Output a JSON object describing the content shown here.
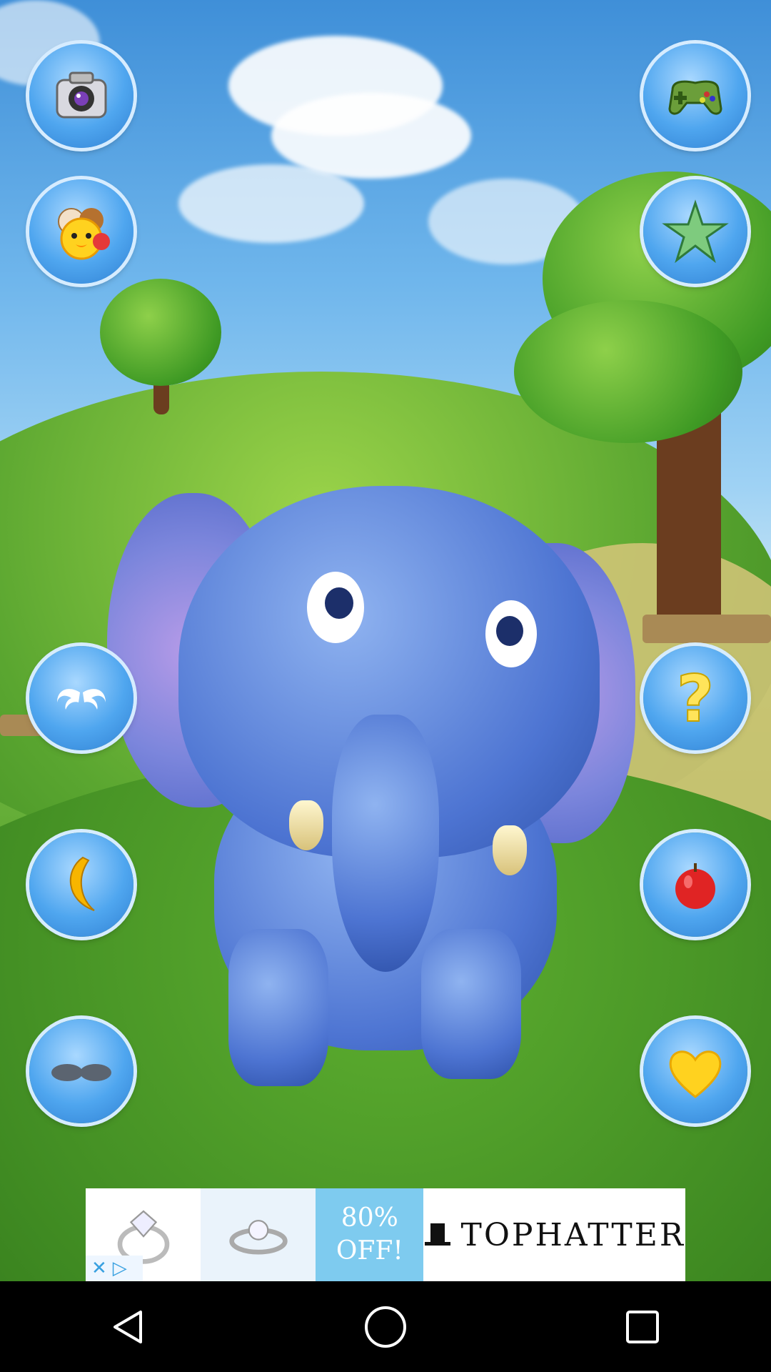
{
  "scene": {
    "character": "elephant"
  },
  "buttons_left": [
    {
      "name": "camera-button",
      "icon": "camera-icon"
    },
    {
      "name": "more-pets-button",
      "icon": "animals-icon"
    },
    {
      "name": "trunk-button",
      "icon": "trunk-icon"
    },
    {
      "name": "banana-button",
      "icon": "banana-icon"
    },
    {
      "name": "glasses-button",
      "icon": "sunglasses-icon"
    }
  ],
  "buttons_right": [
    {
      "name": "games-button",
      "icon": "gamepad-icon"
    },
    {
      "name": "rate-button",
      "icon": "star-icon"
    },
    {
      "name": "help-button",
      "icon": "question-icon",
      "label": "?"
    },
    {
      "name": "apple-button",
      "icon": "apple-icon"
    },
    {
      "name": "love-button",
      "icon": "heart-icon"
    }
  ],
  "ad": {
    "offer_line1": "80%",
    "offer_line2": "OFF!",
    "brand": "TOPHATTER",
    "close_glyph": "✕",
    "play_glyph": "▷"
  },
  "colors": {
    "button_blue": "#4fa6ef",
    "ad_blue": "#7ecbef"
  },
  "navbar": {
    "back": "back-icon",
    "home": "home-icon",
    "recents": "recents-icon"
  }
}
